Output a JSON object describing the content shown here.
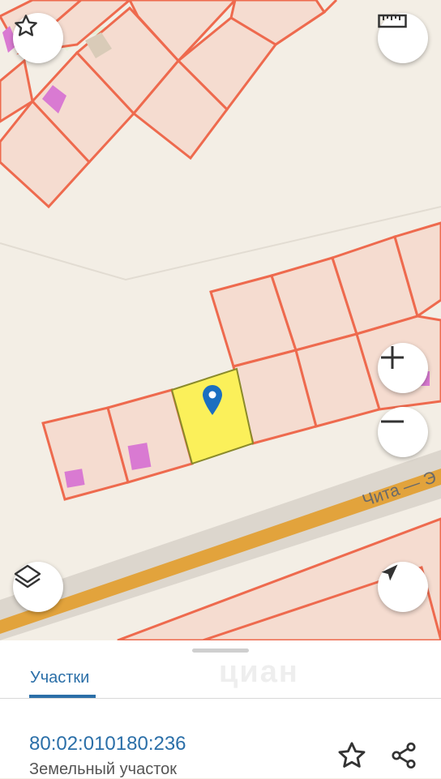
{
  "map": {
    "street_label": "Чита — Э",
    "buttons": {
      "favorite": "star-icon",
      "ruler": "ruler-icon",
      "zoom_in": "plus-icon",
      "zoom_out": "minus-icon",
      "layers": "layers-icon",
      "location": "navigation-arrow-icon"
    },
    "colors": {
      "parcel_stroke": "#ee6a4e",
      "parcel_fill": "#f5dcd0",
      "selected_parcel": "#fbf05a",
      "building": "#d97ad2",
      "road": "#e2a33c",
      "marker": "#1b6fc0"
    }
  },
  "panel": {
    "tabs": [
      {
        "label": "Участки",
        "active": true
      }
    ],
    "watermark": "циан",
    "parcel": {
      "cadastral_number": "80:02:010180:236",
      "type": "Земельный участок"
    },
    "actions": {
      "favorite": "star-icon",
      "share": "share-icon"
    }
  }
}
